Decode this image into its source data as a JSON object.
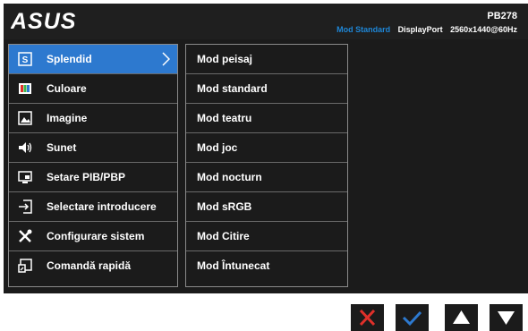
{
  "header": {
    "model": "PB278",
    "mode": "Mod Standard",
    "input": "DisplayPort",
    "resolution": "2560x1440@60Hz",
    "logo_text": "ASUS",
    "accent_color": "#2d79cf"
  },
  "menu": {
    "items": [
      {
        "label": "Splendid",
        "icon": "splendid-icon",
        "active": true
      },
      {
        "label": "Culoare",
        "icon": "color-icon"
      },
      {
        "label": "Imagine",
        "icon": "image-icon"
      },
      {
        "label": "Sunet",
        "icon": "speaker-icon"
      },
      {
        "label": "Setare PIB/PBP",
        "icon": "pip-icon"
      },
      {
        "label": "Selectare introducere",
        "icon": "input-select-icon"
      },
      {
        "label": "Configurare sistem",
        "icon": "tools-icon"
      },
      {
        "label": "Comandă rapidă",
        "icon": "shortcut-icon"
      }
    ]
  },
  "submenu": {
    "items": [
      {
        "label": "Mod peisaj"
      },
      {
        "label": "Mod standard"
      },
      {
        "label": "Mod teatru"
      },
      {
        "label": "Mod joc"
      },
      {
        "label": "Mod nocturn"
      },
      {
        "label": "Mod sRGB"
      },
      {
        "label": "Mod Citire"
      },
      {
        "label": "Mod Întunecat"
      }
    ]
  },
  "buttons": [
    {
      "icon": "close-icon",
      "color": "#e0302a"
    },
    {
      "icon": "check-icon",
      "color": "#2d79cf"
    },
    {
      "icon": "up-arrow-icon",
      "color": "#ffffff"
    },
    {
      "icon": "down-arrow-icon",
      "color": "#ffffff"
    }
  ]
}
